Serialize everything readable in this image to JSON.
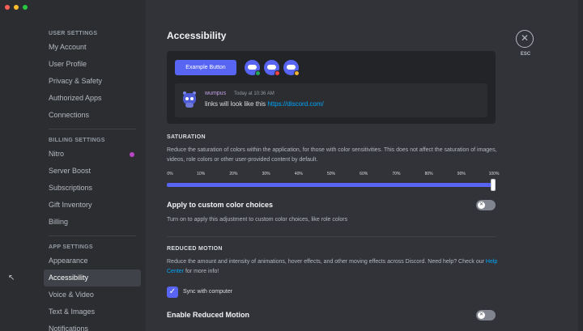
{
  "window": {
    "traffic_colors": [
      "#ff5f57",
      "#febc2e",
      "#28c840"
    ]
  },
  "sidebar": {
    "sections": [
      {
        "header": "USER SETTINGS",
        "items": [
          {
            "label": "My Account"
          },
          {
            "label": "User Profile"
          },
          {
            "label": "Privacy & Safety"
          },
          {
            "label": "Authorized Apps"
          },
          {
            "label": "Connections"
          }
        ]
      },
      {
        "header": "BILLING SETTINGS",
        "items": [
          {
            "label": "Nitro",
            "badge_color": "#b845c1"
          },
          {
            "label": "Server Boost"
          },
          {
            "label": "Subscriptions"
          },
          {
            "label": "Gift Inventory"
          },
          {
            "label": "Billing"
          }
        ]
      },
      {
        "header": "APP SETTINGS",
        "items": [
          {
            "label": "Appearance"
          },
          {
            "label": "Accessibility",
            "active": true
          },
          {
            "label": "Voice & Video"
          },
          {
            "label": "Text & Images"
          },
          {
            "label": "Notifications"
          }
        ]
      }
    ]
  },
  "page": {
    "title": "Accessibility",
    "close_icon": "close-icon",
    "close_label": "ESC"
  },
  "preview": {
    "button_label": "Example Button",
    "avatars": [
      {
        "icon": "discord-avatar-icon",
        "status_color": "#23a55a"
      },
      {
        "icon": "discord-avatar-icon",
        "status_color": "#f23f43"
      },
      {
        "icon": "discord-avatar-icon",
        "status_color": "#f0b232"
      }
    ],
    "message": {
      "author": "wumpus",
      "timestamp": "Today at 10:36 AM",
      "text": "links will look like this ",
      "link": "https://discord.com/"
    }
  },
  "saturation": {
    "header": "SATURATION",
    "description": "Reduce the saturation of colors within the application, for those with color sensitivities. This does not affect the saturation of images, videos, role colors or other user-provided content by default.",
    "tick_labels": [
      "0%",
      "10%",
      "20%",
      "30%",
      "40%",
      "50%",
      "60%",
      "70%",
      "80%",
      "90%",
      "100%"
    ],
    "value_percent": 100
  },
  "custom_colors": {
    "title": "Apply to custom color choices",
    "description": "Turn on to apply this adjustment to custom color choices, like role colors",
    "enabled": false
  },
  "reduced_motion": {
    "header": "REDUCED MOTION",
    "description": "Reduce the amount and intensity of animations, hover effects, and other moving effects across Discord. Need help? Check our ",
    "help_link": "Help Center",
    "description_suffix": " for more info!",
    "sync_label": "Sync with computer",
    "sync_checked": true,
    "enable_title": "Enable Reduced Motion",
    "enabled": false
  }
}
